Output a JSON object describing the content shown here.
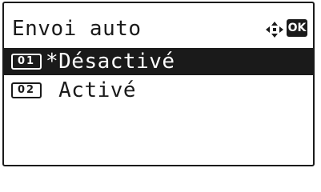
{
  "screen": {
    "title": "Envoi auto",
    "nav_icon": "four-way-arrow-icon",
    "ok_key_label": "OK"
  },
  "menu": {
    "items": [
      {
        "number": "01",
        "label": "*Désactivé",
        "selected": true
      },
      {
        "number": "02",
        "label": " Activé",
        "selected": false
      }
    ]
  },
  "colors": {
    "foreground": "#1a1a1a",
    "background": "#ffffff",
    "highlight": "#1a1a1a"
  }
}
